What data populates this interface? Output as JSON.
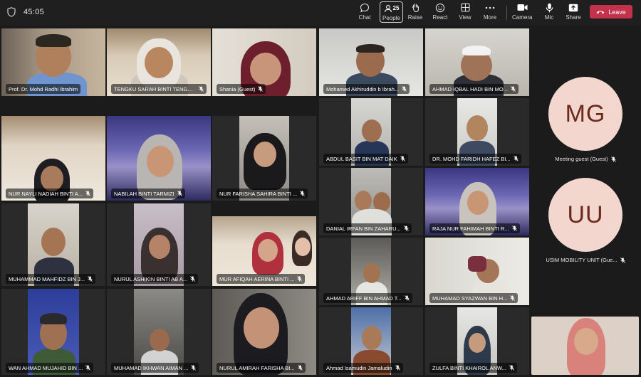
{
  "meeting": {
    "timer": "45:05"
  },
  "toolbar": {
    "chat": "Chat",
    "people": "People",
    "people_count": "25",
    "raise": "Raise",
    "react": "React",
    "view": "View",
    "more": "More",
    "camera": "Camera",
    "mic": "Mic",
    "share": "Share",
    "leave": "Leave"
  },
  "participants": [
    "Prof. Dr. Mohd Radhi Ibrahim",
    "TENGKU SARAH BINTI TENGKU ...",
    "Shania (Guest)",
    "Mohamed Akhiruddin b Ibrah...",
    "AHMAD IQBAL HADI BIN MO...",
    "NUR NAYLI NADIAH BINTI A...",
    "NABILAH BINTI TARMIZI",
    "NUR FARISHA SAHIRA BINTI ...",
    "ABDUL BASIT BIN MAT DAIK",
    "DR. MOHD FARIDH HAFEZ BI...",
    "MUHAMMAD MAHFIDZ BIN J...",
    "NURUL ASHIKIN BINTI AB A...",
    "MUR AFIQAH AERINA BINTI ...",
    "DANIAL IRFAN BIN ZAHARU...",
    "RAJA NUR FAHIMAH BINTI R...",
    "WAN AHMAD MUJAHID BIN ...",
    "MUHAMAD IKHWAN AIMAN ...",
    "NURUL AMIRAH FARISHA BI...",
    "AHMAD ARIFF BIN AHMAD T...",
    "MUHAMAD SYAZWAN BIN H...",
    "Ahmad Isamudin Jamaludin",
    "ZULFA BINTI KHAIROL ANW..."
  ],
  "guests": [
    {
      "initials": "MG",
      "name": "Meeting guest (Guest)"
    },
    {
      "initials": "UU",
      "name": "USIM MOBILITY UNIT (Gue..."
    }
  ],
  "colors": {
    "leave": "#c4314b",
    "avatar_bg": "#f3d7cf",
    "avatar_text": "#6b2a1c"
  }
}
